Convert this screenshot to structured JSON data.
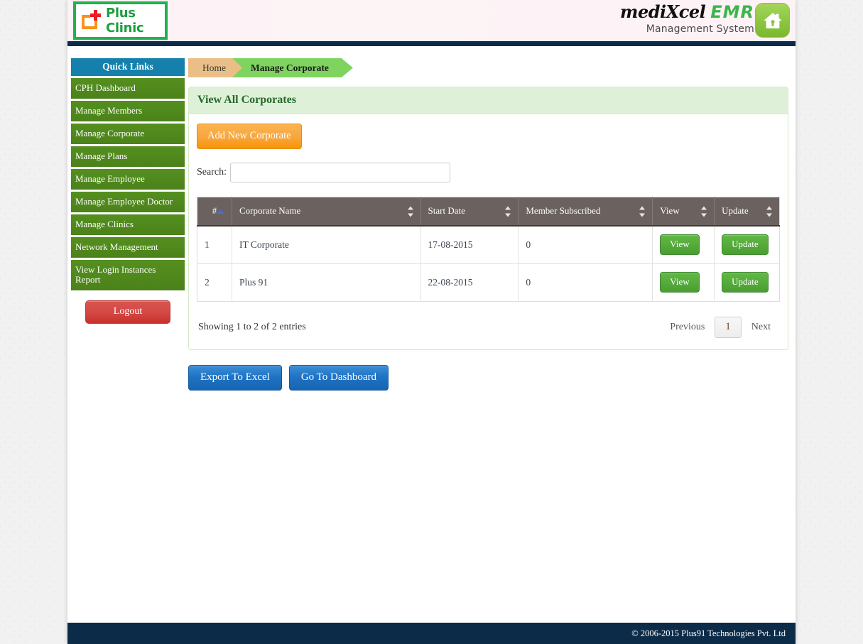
{
  "header": {
    "logo_text": "Plus Clinic",
    "logo_icon": "plus-clinic-cross-icon",
    "brand_name": "mediXcel",
    "brand_suffix": "EMR",
    "brand_tagline": "Management System",
    "home_icon": "home-house-keyhole-icon"
  },
  "sidebar": {
    "title": "Quick Links",
    "items": [
      {
        "label": "CPH Dashboard"
      },
      {
        "label": "Manage Members"
      },
      {
        "label": "Manage Corporate"
      },
      {
        "label": "Manage Plans"
      },
      {
        "label": "Manage Employee"
      },
      {
        "label": "Manage Employee Doctor"
      },
      {
        "label": "Manage Clinics"
      },
      {
        "label": "Network Management"
      },
      {
        "label": "View Login Instances Report"
      }
    ],
    "logout_label": "Logout"
  },
  "breadcrumb": {
    "home": "Home",
    "current": "Manage Corporate"
  },
  "panel": {
    "heading": "View All Corporates",
    "add_button": "Add New Corporate",
    "search_label": "Search:",
    "search_value": "",
    "search_placeholder": ""
  },
  "table": {
    "columns": [
      {
        "label": "#",
        "sort": "asc"
      },
      {
        "label": "Corporate Name",
        "sort": "none"
      },
      {
        "label": "Start Date",
        "sort": "none"
      },
      {
        "label": "Member Subscribed",
        "sort": "none"
      },
      {
        "label": "View",
        "sort": "none"
      },
      {
        "label": "Update",
        "sort": "none"
      }
    ],
    "rows": [
      {
        "num": "1",
        "name": "IT Corporate",
        "start_date": "17-08-2015",
        "members": "0",
        "view_label": "View",
        "update_label": "Update"
      },
      {
        "num": "2",
        "name": "Plus 91",
        "start_date": "22-08-2015",
        "members": "0",
        "view_label": "View",
        "update_label": "Update"
      }
    ],
    "info": "Showing 1 to 2 of 2 entries",
    "pagination": {
      "previous": "Previous",
      "pages": [
        "1"
      ],
      "next": "Next",
      "active": "1"
    }
  },
  "actions": {
    "export_label": "Export To Excel",
    "dashboard_label": "Go To Dashboard"
  },
  "footer": {
    "copyright": "© 2006-2015 Plus91 Technologies Pvt. Ltd"
  },
  "colors": {
    "sidebar_header": "#1480ab",
    "sidebar_item": "#4d8f1b",
    "logout": "#d9534f",
    "panel_header": "#dff0d8",
    "panel_heading_text": "#26682b",
    "add_button": "#f89406",
    "grid_button": "#56ab3c",
    "blue_button": "#1f72c4",
    "table_header": "#6b625f",
    "navy": "#0c2b48",
    "breadcrumb_home": "#eabf87",
    "breadcrumb_current": "#7ed45f"
  }
}
